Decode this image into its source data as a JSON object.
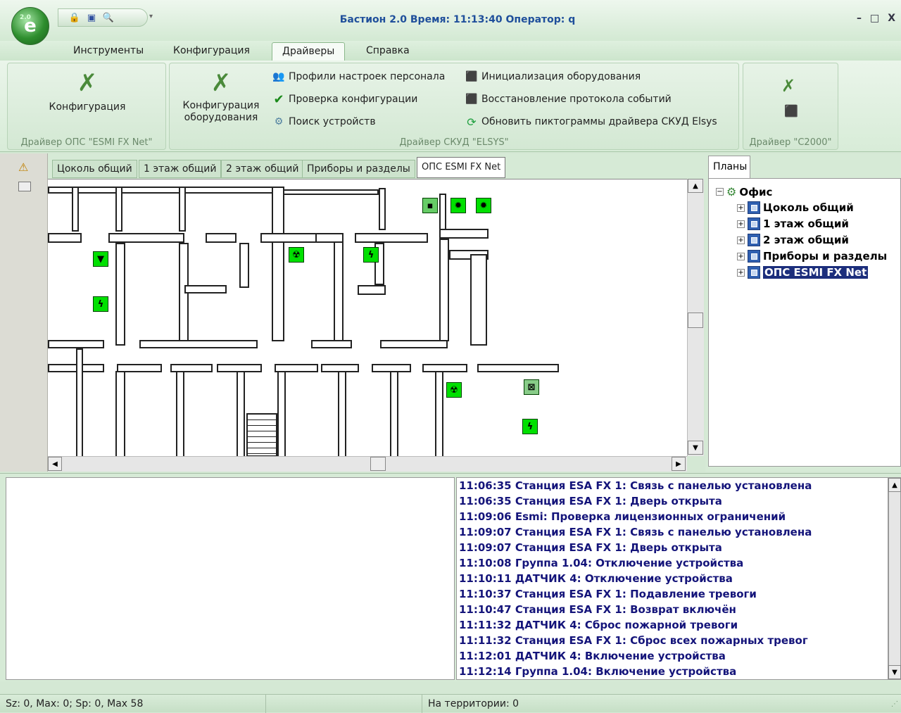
{
  "window": {
    "title": "Бастион 2.0 Время: 11:13:40 Оператор: q",
    "orb_version": "2.0",
    "controls": [
      "–",
      "□",
      "X"
    ]
  },
  "quick_access": {
    "icons": [
      "lock-icon",
      "window-icon",
      "search-doc-icon"
    ],
    "more_glyph": "▾"
  },
  "ribbon_tabs": [
    "Инструменты",
    "Конфигурация",
    "Драйверы",
    "Справка"
  ],
  "ribbon": {
    "group1": {
      "button": "Конфигурация",
      "label": "Драйвер ОПС \"ESMI FX Net\""
    },
    "group2": {
      "big_button": "Конфигурация оборудования",
      "col1": [
        "Профили настроек персонала",
        "Проверка конфигурации",
        "Поиск устройств"
      ],
      "col2": [
        "Инициализация оборудования",
        "Восстановление протокола событий",
        "Обновить пиктограммы драйвера СКУД Elsys"
      ],
      "label": "Драйвер СКУД \"ELSYS\""
    },
    "group3": {
      "label": "Драйвер \"С2000\""
    }
  },
  "doc_tabs": [
    "Цоколь общий",
    "1 этаж общий",
    "2 этаж общий",
    "Приборы и разделы",
    "ОПС ESMI FX Net"
  ],
  "plans_panel": {
    "tab": "Планы",
    "root": "Офис",
    "items": [
      "Цоколь общий",
      "1 этаж общий",
      "2 этаж общий",
      "Приборы и разделы",
      "ОПС ESMI FX Net"
    ]
  },
  "event_log": [
    "11:06:35 Станция ESA FX 1: Связь с панелью установлена",
    "11:06:35 Станция ESA FX 1: Дверь открыта",
    "11:09:06 Esmi: Проверка лицензионных ограничений",
    "11:09:07 Станция ESA FX 1: Связь с панелью установлена",
    "11:09:07 Станция ESA FX 1: Дверь открыта",
    "11:10:08 Группа 1.04: Отключение устройства",
    "11:10:11 ДАТЧИК 4: Отключение устройства",
    "11:10:37 Станция ESA FX 1: Подавление тревоги",
    "11:10:47 Станция ESA FX 1: Возврат включён",
    "11:11:32 ДАТЧИК 4: Сброс пожарной тревоги",
    "11:11:32 Станция ESA FX 1: Сброс всех пожарных тревог",
    "11:12:01 ДАТЧИК 4: Включение устройства",
    "11:12:14 Группа 1.04: Включение устройства"
  ],
  "status": {
    "left": "Sz: 0, Max: 0; Sp: 0, Max 58",
    "middle": "",
    "territory": "На территории: 0"
  },
  "colors": {
    "device": "#00e000",
    "log_text": "#14147a",
    "title": "#1f4f9b",
    "selection": "#1c2e7c"
  }
}
